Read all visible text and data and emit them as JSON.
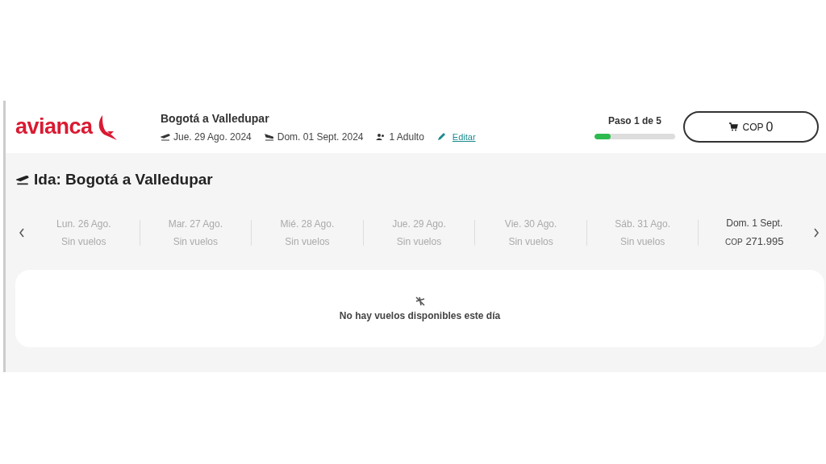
{
  "header": {
    "logo": "avianca",
    "route": "Bogotá a Valledupar",
    "depart_date": "Jue. 29 Ago. 2024",
    "return_date": "Dom. 01 Sept. 2024",
    "passengers": "1 Adulto",
    "edit_link": "Editar"
  },
  "progress": {
    "label": "Paso 1 de 5",
    "level": 0.2
  },
  "cart": {
    "currency": "COP",
    "amount": "0"
  },
  "section_title": "Ida: Bogotá a Valledupar",
  "days": [
    {
      "date": "Lun. 26 Ago.",
      "available": false,
      "info": "Sin vuelos"
    },
    {
      "date": "Mar. 27 Ago.",
      "available": false,
      "info": "Sin vuelos"
    },
    {
      "date": "Mié. 28 Ago.",
      "available": false,
      "info": "Sin vuelos"
    },
    {
      "date": "Jue. 29 Ago.",
      "available": false,
      "info": "Sin vuelos"
    },
    {
      "date": "Vie. 30 Ago.",
      "available": false,
      "info": "Sin vuelos"
    },
    {
      "date": "Sáb. 31 Ago.",
      "available": false,
      "info": "Sin vuelos"
    },
    {
      "date": "Dom. 1 Sept.",
      "available": true,
      "currency": "COP",
      "amount": "271.995"
    }
  ],
  "empty_message": "No hay vuelos disponibles este día"
}
